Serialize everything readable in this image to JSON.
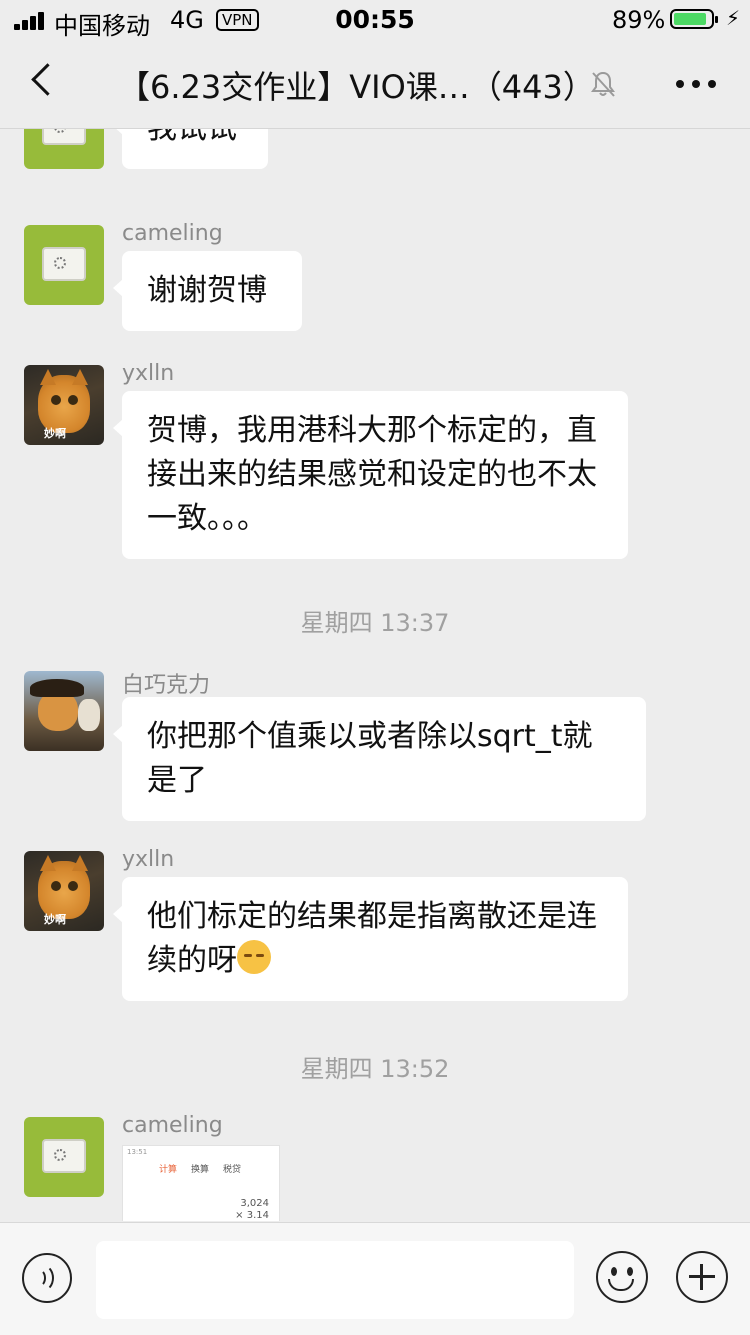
{
  "status_bar": {
    "carrier": "中国移动",
    "network": "4G",
    "vpn": "VPN",
    "time": "00:55",
    "battery_percent": "89%",
    "battery_level": 0.89
  },
  "nav": {
    "title": "【6.23交作业】VIO课…（443）"
  },
  "messages": [
    {
      "sender": "",
      "text": "我试试"
    },
    {
      "sender": "cameling",
      "text": "谢谢贺博"
    },
    {
      "sender": "yxlln",
      "text": "贺博，我用港科大那个标定的，直接出来的结果感觉和设定的也不太一致。。。"
    },
    {
      "time": "星期四 13:37"
    },
    {
      "sender": "白巧克力",
      "text": "你把那个值乘以或者除以sqrt_t就是了"
    },
    {
      "sender": "yxlln",
      "text": "他们标定的结果都是指离散还是连续的呀"
    },
    {
      "time": "星期四 13:52"
    },
    {
      "sender": "cameling",
      "image_preview": {
        "status": "13:51",
        "tabs": [
          "计算",
          "换算",
          "税贷"
        ],
        "active_tab": "计算",
        "value1": "3,024",
        "value2": "× 3.14"
      }
    }
  ],
  "avatars": {
    "cat_caption": "妙啊"
  },
  "input": {
    "placeholder": ""
  }
}
